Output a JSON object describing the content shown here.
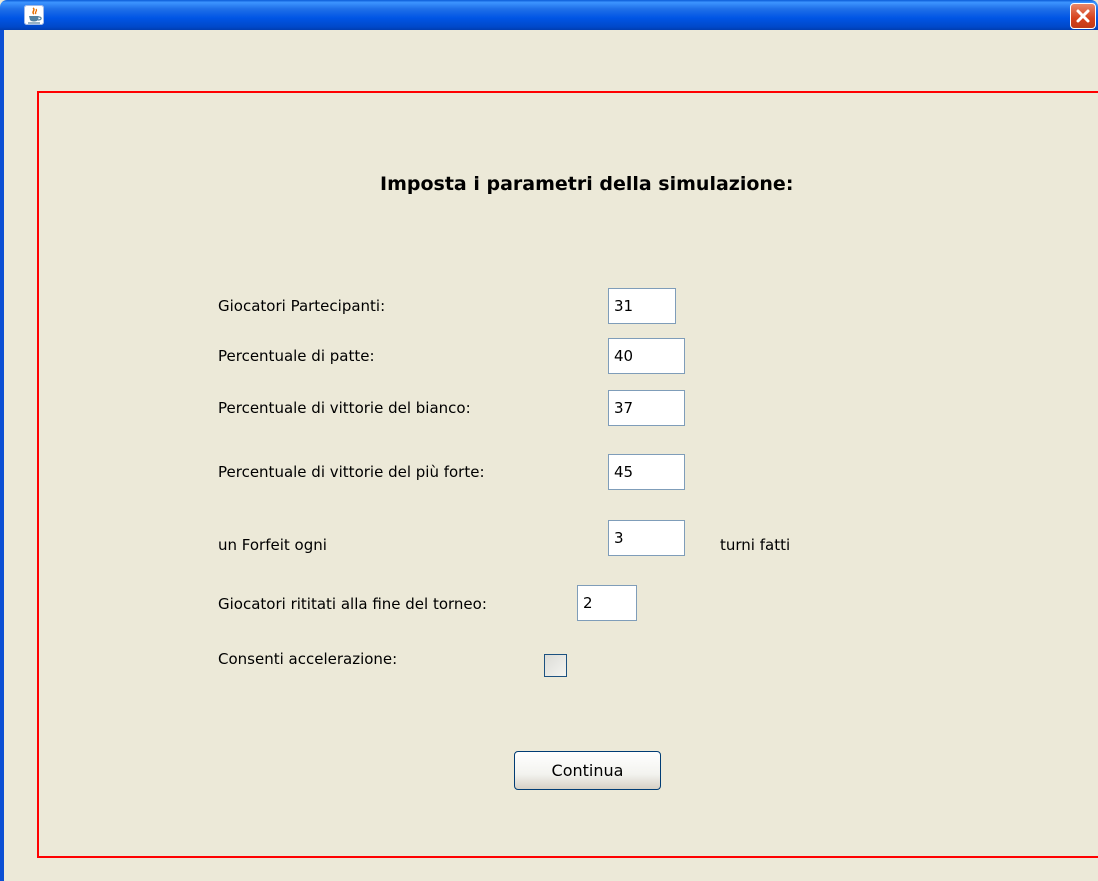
{
  "window": {
    "icons": {
      "app": "java-icon",
      "close": "close-icon"
    },
    "title_bar_color": "#0055E5"
  },
  "heading": "Imposta i parametri della simulazione:",
  "fields": [
    {
      "label": "Giocatori Partecipanti:",
      "value": "31"
    },
    {
      "label": "Percentuale di patte:",
      "value": "40"
    },
    {
      "label": "Percentuale di vittorie del bianco:",
      "value": "37"
    },
    {
      "label": "Percentuale di vittorie del più forte:",
      "value": "45"
    },
    {
      "label": "un Forfeit ogni",
      "value": "3",
      "suffix": "turni fatti"
    },
    {
      "label": "Giocatori rititati alla fine del torneo:",
      "value": "2"
    }
  ],
  "acceleration": {
    "label": "Consenti accelerazione:",
    "checked": false
  },
  "continue_button": "Continua",
  "colors": {
    "panel_border": "#FF0000",
    "background": "#ECE9D8"
  }
}
